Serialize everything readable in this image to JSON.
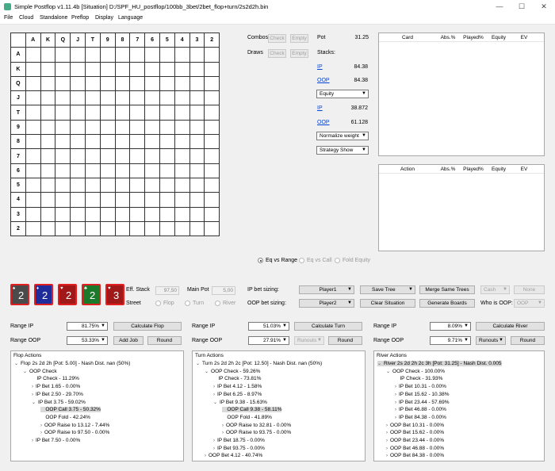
{
  "window": {
    "title": "Simple Postflop v1.11.4b [Situation] D:/SPF_HU_postflop/100bb_3bet/2bet_flop+turn/2s2d2h.bin"
  },
  "window_controls": {
    "minimize": "—",
    "maximize": "☐",
    "close": "✕"
  },
  "menu": [
    "File",
    "Cloud",
    "Standalone",
    "Preflop",
    "Display",
    "Language"
  ],
  "matrix": {
    "ranks": [
      "A",
      "K",
      "Q",
      "J",
      "T",
      "9",
      "8",
      "7",
      "6",
      "5",
      "4",
      "3",
      "2"
    ]
  },
  "combos": {
    "label": "Combos",
    "check": "Check",
    "empty": "Empty"
  },
  "draws": {
    "label": "Draws",
    "check": "Check",
    "empty": "Empty"
  },
  "pot": {
    "label": "Pot",
    "value": "31.25"
  },
  "stacks": {
    "label": "Stacks:",
    "ip_label": "IP",
    "ip_value": "84.38",
    "oop_label": "OOP",
    "oop_value": "84.38"
  },
  "metric_select": "Equity",
  "equity": {
    "ip_label": "IP",
    "ip_value": "38.872",
    "oop_label": "OOP",
    "oop_value": "61.128"
  },
  "normalize_select": "Normalize weight",
  "strategy_select": "Strategy Show",
  "card_table": {
    "headers": [
      "Card",
      "Abs.%",
      "Played%",
      "Equity",
      "EV"
    ]
  },
  "action_table": {
    "headers": [
      "Action",
      "Abs.%",
      "Played%",
      "Equity",
      "EV"
    ]
  },
  "eq_modes": [
    "Eq vs Range",
    "Eq vs Call",
    "Fold Equity"
  ],
  "board_cards": [
    {
      "rank": "2",
      "suit": "♠",
      "color": "#4a4a4a"
    },
    {
      "rank": "2",
      "suit": "♦",
      "color": "#1e2c9c"
    },
    {
      "rank": "2",
      "suit": "♥",
      "color": "#a01818"
    },
    {
      "rank": "2",
      "suit": "♣",
      "color": "#1a7a2a"
    },
    {
      "rank": "3",
      "suit": "♥",
      "color": "#a01818"
    }
  ],
  "eff_stack": {
    "label": "Eff. Stack",
    "value": "97,50"
  },
  "main_pot": {
    "label": "Main Pot",
    "value": "5,00"
  },
  "street": {
    "label": "Street",
    "options": [
      "Flop",
      "Turn",
      "River"
    ]
  },
  "ip_bet_sizing": {
    "label": "IP bet sizing:",
    "value": "Player1"
  },
  "oop_bet_sizing": {
    "label": "OOP bet sizing:",
    "value": "Player2"
  },
  "buttons": {
    "save_tree": "Save Tree",
    "clear_situation": "Clear Situation",
    "merge_same_trees": "Merge Same Trees",
    "generate_boards": "Generate Boards",
    "cash": "Cash",
    "none": "None",
    "who_is_oop_label": "Who is OOP:",
    "who_is_oop_value": "OOP"
  },
  "flop": {
    "range_ip_label": "Range IP",
    "range_ip": "81.75%",
    "range_oop_label": "Range OOP",
    "range_oop": "53.33%",
    "calc": "Calculate Flop",
    "add_job": "Add Job",
    "round": "Round"
  },
  "turn": {
    "range_ip_label": "Range IP",
    "range_ip": "51.03%",
    "range_oop_label": "Range OOP",
    "range_oop": "27.91%",
    "calc": "Calculate Turn",
    "runouts": "Runouts",
    "round": "Round"
  },
  "river": {
    "range_ip_label": "Range IP",
    "range_ip": "8.09%",
    "range_oop_label": "Range OOP",
    "range_oop": "9.71%",
    "calc": "Calculate River",
    "runouts": "Runouts",
    "round": "Round"
  },
  "flop_actions": {
    "title": "Flop Actions",
    "nodes": [
      {
        "text": "Flop 2s 2d 2h [Pot: 5.00] - Nash Dist. nan (50%)",
        "lvl": 0,
        "chev": "v",
        "sel": false
      },
      {
        "text": "OOP Check",
        "lvl": 1,
        "chev": "v",
        "sel": false
      },
      {
        "text": "IP Check - 11.29%",
        "lvl": 2,
        "chev": "",
        "sel": false
      },
      {
        "text": "IP Bet 1.65 - 0.00%",
        "lvl": 2,
        "chev": ">",
        "sel": false
      },
      {
        "text": "IP Bet 2.50 - 29.70%",
        "lvl": 2,
        "chev": ">",
        "sel": false
      },
      {
        "text": "IP Bet 3.75 - 59.02%",
        "lvl": 2,
        "chev": "v",
        "sel": false
      },
      {
        "text": "OOP Call 3.75 - 50.32%",
        "lvl": 3,
        "chev": "",
        "sel": true
      },
      {
        "text": "OOP Fold - 42.24%",
        "lvl": 3,
        "chev": "",
        "sel": false
      },
      {
        "text": "OOP Raise to 13.12 - 7.44%",
        "lvl": 3,
        "chev": ">",
        "sel": false
      },
      {
        "text": "OOP Raise to 97.50 - 0.00%",
        "lvl": 3,
        "chev": ">",
        "sel": false
      },
      {
        "text": "IP Bet 7.50 - 0.00%",
        "lvl": 2,
        "chev": ">",
        "sel": false
      }
    ]
  },
  "turn_actions": {
    "title": "Turn Actions",
    "nodes": [
      {
        "text": "Turn 2s 2d 2h 2c [Pot: 12.50] - Nash Dist. nan (50%)",
        "lvl": 0,
        "chev": "v",
        "sel": false
      },
      {
        "text": "OOP Check - 59.26%",
        "lvl": 1,
        "chev": "v",
        "sel": false
      },
      {
        "text": "IP Check - 73.81%",
        "lvl": 2,
        "chev": "",
        "sel": false
      },
      {
        "text": "IP Bet 4.12 - 1.58%",
        "lvl": 2,
        "chev": ">",
        "sel": false
      },
      {
        "text": "IP Bet 6.25 - 8.97%",
        "lvl": 2,
        "chev": ">",
        "sel": false
      },
      {
        "text": "IP Bet 9.38 - 15.63%",
        "lvl": 2,
        "chev": "v",
        "sel": false
      },
      {
        "text": "OOP Call 9.38 - 58.11%",
        "lvl": 3,
        "chev": "",
        "sel": true
      },
      {
        "text": "OOP Fold - 41.89%",
        "lvl": 3,
        "chev": "",
        "sel": false
      },
      {
        "text": "OOP Raise to 32.81 - 0.00%",
        "lvl": 3,
        "chev": ">",
        "sel": false
      },
      {
        "text": "OOP Raise to 93.75 - 0.00%",
        "lvl": 3,
        "chev": ">",
        "sel": false
      },
      {
        "text": "IP Bet 18.75 - 0.00%",
        "lvl": 2,
        "chev": ">",
        "sel": false
      },
      {
        "text": "IP Bet 93.75 - 0.00%",
        "lvl": 2,
        "chev": ">",
        "sel": false
      },
      {
        "text": "OOP Bet 4.12 - 40.74%",
        "lvl": 1,
        "chev": ">",
        "sel": false
      }
    ]
  },
  "river_actions": {
    "title": "River Actions",
    "nodes": [
      {
        "text": "River 2s 2d 2h 2c 3h [Pot: 31.25] - Nash Dist. 0.005",
        "lvl": 0,
        "chev": "v",
        "sel": true
      },
      {
        "text": "OOP Check - 100.00%",
        "lvl": 1,
        "chev": "v",
        "sel": false
      },
      {
        "text": "IP Check - 31.93%",
        "lvl": 2,
        "chev": "",
        "sel": false
      },
      {
        "text": "IP Bet 10.31 - 0.00%",
        "lvl": 2,
        "chev": ">",
        "sel": false
      },
      {
        "text": "IP Bet 15.62 - 10.38%",
        "lvl": 2,
        "chev": ">",
        "sel": false
      },
      {
        "text": "IP Bet 23.44 - 57.69%",
        "lvl": 2,
        "chev": ">",
        "sel": false
      },
      {
        "text": "IP Bet 46.88 - 0.00%",
        "lvl": 2,
        "chev": ">",
        "sel": false
      },
      {
        "text": "IP Bet 84.38 - 0.00%",
        "lvl": 2,
        "chev": ">",
        "sel": false
      },
      {
        "text": "OOP Bet 10.31 - 0.00%",
        "lvl": 1,
        "chev": ">",
        "sel": false
      },
      {
        "text": "OOP Bet 15.62 - 0.00%",
        "lvl": 1,
        "chev": ">",
        "sel": false
      },
      {
        "text": "OOP Bet 23.44 - 0.00%",
        "lvl": 1,
        "chev": ">",
        "sel": false
      },
      {
        "text": "OOP Bet 46.88 - 0.00%",
        "lvl": 1,
        "chev": ">",
        "sel": false
      },
      {
        "text": "OOP Bet 84.38 - 0.00%",
        "lvl": 1,
        "chev": ">",
        "sel": false
      }
    ]
  }
}
